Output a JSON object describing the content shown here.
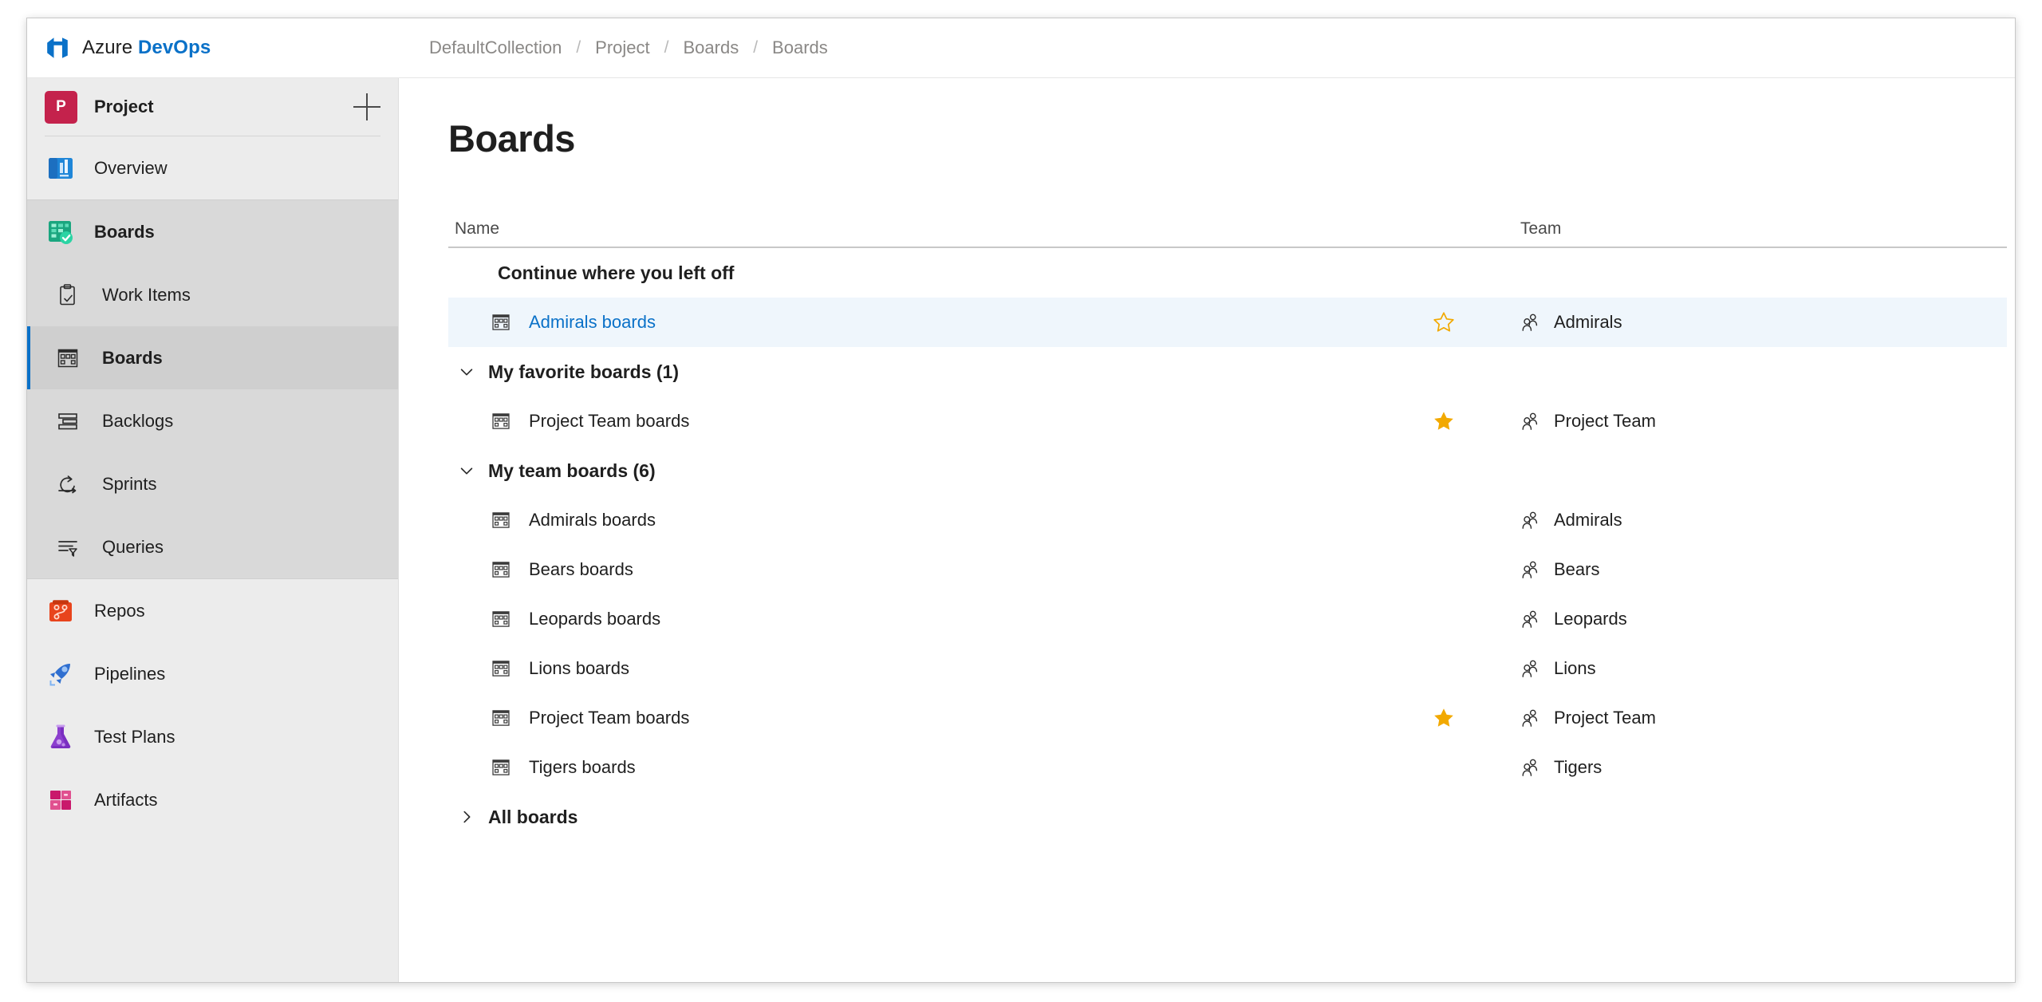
{
  "header": {
    "brand_light": "Azure ",
    "brand_bold": "DevOps",
    "logo_icon": "azure-devops-logo",
    "breadcrumb": [
      "DefaultCollection",
      "Project",
      "Boards",
      "Boards"
    ],
    "breadcrumb_separator": "/"
  },
  "sidebar": {
    "project": {
      "avatar_letter": "P",
      "avatar_color": "#C4224C",
      "name": "Project",
      "add_button_icon": "plus-icon"
    },
    "items": [
      {
        "label": "Overview",
        "icon": "overview-icon",
        "selected": false,
        "sub": false
      },
      {
        "label": "Boards",
        "icon": "boards-suite-icon",
        "selected": false,
        "sub": false,
        "bold": true
      },
      {
        "label": "Work Items",
        "icon": "work-items-icon",
        "selected": false,
        "sub": true
      },
      {
        "label": "Boards",
        "icon": "board-grid-icon",
        "selected": true,
        "sub": true
      },
      {
        "label": "Backlogs",
        "icon": "backlogs-icon",
        "selected": false,
        "sub": true
      },
      {
        "label": "Sprints",
        "icon": "sprints-icon",
        "selected": false,
        "sub": true
      },
      {
        "label": "Queries",
        "icon": "queries-icon",
        "selected": false,
        "sub": true
      },
      {
        "label": "Repos",
        "icon": "repos-icon",
        "selected": false,
        "sub": false
      },
      {
        "label": "Pipelines",
        "icon": "pipelines-icon",
        "selected": false,
        "sub": false
      },
      {
        "label": "Test Plans",
        "icon": "test-plans-icon",
        "selected": false,
        "sub": false
      },
      {
        "label": "Artifacts",
        "icon": "artifacts-icon",
        "selected": false,
        "sub": false
      }
    ]
  },
  "main": {
    "title": "Boards",
    "columns": {
      "name": "Name",
      "team": "Team"
    },
    "sections": [
      {
        "title": "Continue where you left off",
        "expandable": false,
        "expanded": true,
        "chevron": "none",
        "rows": [
          {
            "name": "Admirals boards",
            "team": "Admirals",
            "star": "outline",
            "highlight": true,
            "icon": "board-grid-icon",
            "team_icon": "people-icon"
          }
        ]
      },
      {
        "title": "My favorite boards (1)",
        "expandable": true,
        "expanded": true,
        "chevron": "chevron-down-icon",
        "rows": [
          {
            "name": "Project Team boards",
            "team": "Project Team",
            "star": "filled",
            "highlight": false,
            "icon": "board-grid-icon",
            "team_icon": "people-icon"
          }
        ]
      },
      {
        "title": "My team boards (6)",
        "expandable": true,
        "expanded": true,
        "chevron": "chevron-down-icon",
        "rows": [
          {
            "name": "Admirals boards",
            "team": "Admirals",
            "star": "none",
            "highlight": false,
            "icon": "board-grid-icon",
            "team_icon": "people-icon"
          },
          {
            "name": "Bears boards",
            "team": "Bears",
            "star": "none",
            "highlight": false,
            "icon": "board-grid-icon",
            "team_icon": "people-icon"
          },
          {
            "name": "Leopards boards",
            "team": "Leopards",
            "star": "none",
            "highlight": false,
            "icon": "board-grid-icon",
            "team_icon": "people-icon"
          },
          {
            "name": "Lions boards",
            "team": "Lions",
            "star": "none",
            "highlight": false,
            "icon": "board-grid-icon",
            "team_icon": "people-icon"
          },
          {
            "name": "Project Team boards",
            "team": "Project Team",
            "star": "filled",
            "highlight": false,
            "icon": "board-grid-icon",
            "team_icon": "people-icon"
          },
          {
            "name": "Tigers boards",
            "team": "Tigers",
            "star": "none",
            "highlight": false,
            "icon": "board-grid-icon",
            "team_icon": "people-icon"
          }
        ]
      },
      {
        "title": "All boards",
        "expandable": true,
        "expanded": false,
        "chevron": "chevron-right-icon",
        "rows": []
      }
    ]
  },
  "colors": {
    "accent_blue": "#0a71c8",
    "link_blue": "#0a71c8",
    "star_orange": "#F2A900",
    "row_highlight": "#eff6fc",
    "sidebar_bg": "#ececec",
    "sidebar_group_bg": "#d9d9d9",
    "sidebar_selected_bg": "#cfcfcf"
  }
}
